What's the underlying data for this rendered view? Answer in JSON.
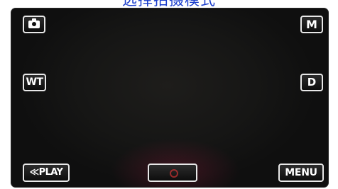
{
  "caption": {
    "text": "选择拍摄模式"
  },
  "controls": {
    "camera_icon": "camera-icon",
    "wt_label": "WT",
    "manual_label": "M",
    "display_label": "D",
    "play_label": "≪PLAY",
    "menu_label": "MENU",
    "record_icon": "record-icon"
  },
  "colors": {
    "caption": "#1a3dcc",
    "screen_bg": "#161615",
    "button_border": "#e8e8e8",
    "record_accent": "#ff3a3a"
  }
}
